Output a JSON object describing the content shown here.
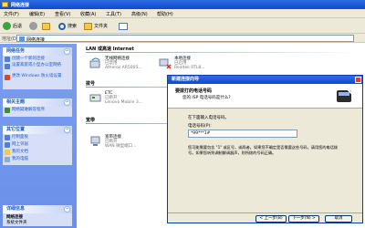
{
  "window": {
    "title": "网络连接"
  },
  "menu": [
    "文件(F)",
    "编辑(E)",
    "查看(V)",
    "收藏(A)",
    "工具(T)",
    "高级(N)",
    "帮助(H)"
  ],
  "toolbar": {
    "back": "后退",
    "search": "搜索",
    "folders": "文件夹"
  },
  "address": {
    "label": "地址(D)",
    "value": "网络连接"
  },
  "left_panels": {
    "network_tasks": {
      "title": "网络任务",
      "items": [
        "创建一个新的连接",
        "设置家庭或小型办公室网络",
        "更改 Windows 防火墙设置"
      ]
    },
    "see_also": {
      "title": "相关主题",
      "items": [
        "网络疑难解答程序"
      ]
    },
    "other_places": {
      "title": "其它位置",
      "items": [
        "控制面板",
        "网上邻居",
        "我的文档",
        "我的电脑"
      ]
    },
    "details": {
      "title": "详细信息",
      "line1": "网络连接",
      "line2": "系统文件夹"
    }
  },
  "groups": {
    "lan": "LAN 或高速 Internet",
    "dialup": "拨号",
    "broadband": "宽带"
  },
  "connections": {
    "wireless": {
      "name": "无线网络连接",
      "status": "已禁用",
      "device": "Atheros AR5005..."
    },
    "local": {
      "name": "本地连接",
      "status": "已启用",
      "device": "Realtek RTL8..."
    },
    "modem": {
      "name": "ETC",
      "status": "已断开",
      "device": "Lenovo Mobile 3..."
    },
    "broadband": {
      "name": "宽带连接",
      "status": "已断开",
      "device": "WAN 微型端口..."
    }
  },
  "dialog": {
    "title": "新建连接向导",
    "heading": "要拨打的电话号码",
    "subheading": "您的 ISP 电话号码是什么?",
    "prompt": "在下面输入电话号码。",
    "field_label": "电话号码(P):",
    "field_value": "*99***1#",
    "help": "您可能需要包含 \"1\" 或区号，或两者。如果您不确定是否需要这些号码，请用您的电话拨号。如果您听到调制解调器声，则所拨的号码正确。",
    "buttons": {
      "back": "< 上一步(B)",
      "next": "下一步(N) >",
      "cancel": "取消"
    }
  }
}
